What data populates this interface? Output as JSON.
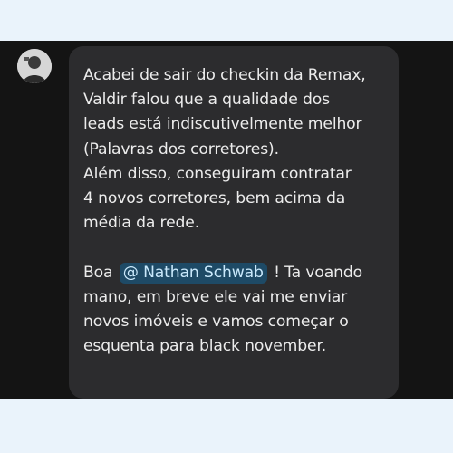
{
  "message": {
    "paragraph1_lines": [
      "Acabei de sair do checkin da Remax,",
      "Valdir falou que a qualidade dos",
      "leads está indiscutivelmente melhor",
      "(Palavras dos corretores).",
      "Além disso, conseguiram contratar",
      "4 novos corretores, bem acima da",
      "média da rede."
    ],
    "paragraph2": {
      "prefix": "Boa",
      "mention": "@ Nathan Schwab",
      "suffix": "! Ta voando",
      "lines": [
        "mano, em breve ele vai me enviar",
        "novos imóveis e vamos começar o",
        "esquenta para black november."
      ]
    }
  },
  "colors": {
    "page_background": "#eaf3fb",
    "chat_background": "#141414",
    "bubble_background": "#2c2c2e",
    "text": "#ececec",
    "mention_background": "#1e4a66",
    "mention_text": "#c9e8fb"
  }
}
